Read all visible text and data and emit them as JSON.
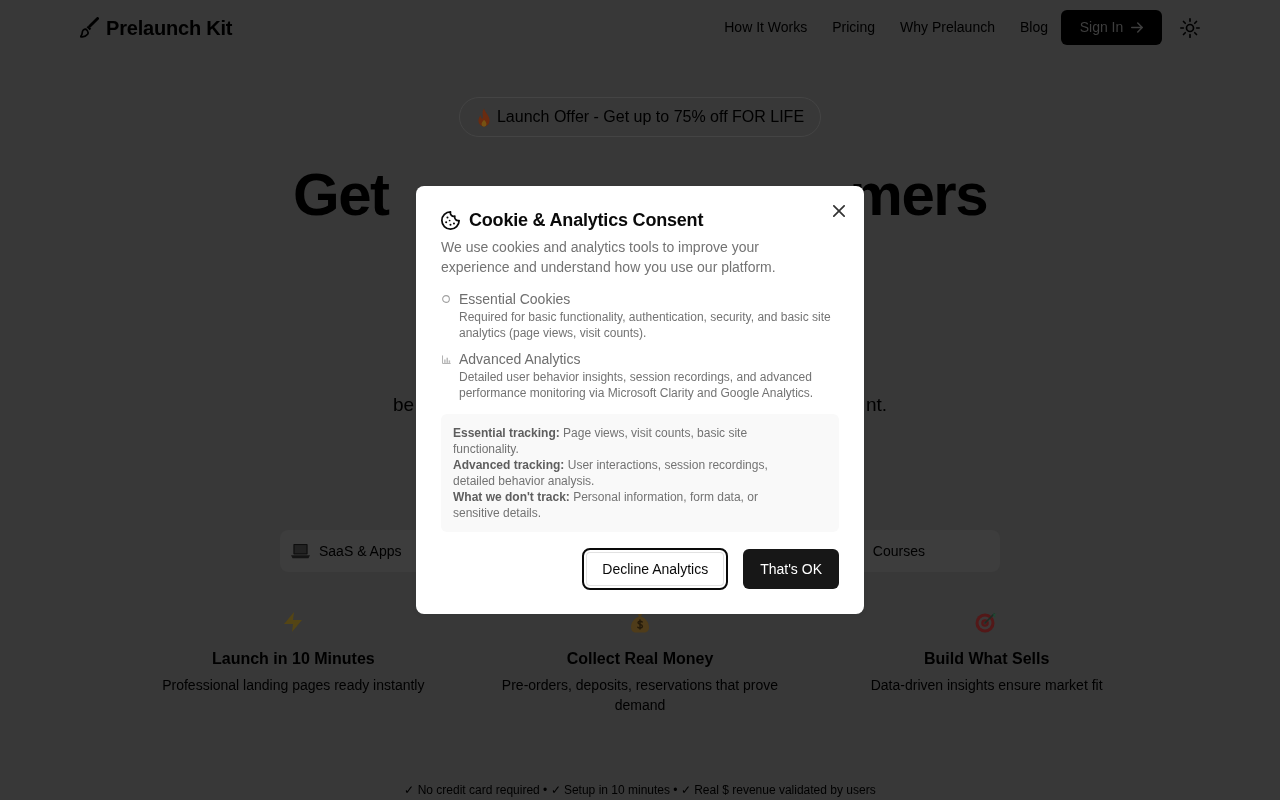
{
  "header": {
    "logo": "Prelaunch Kit",
    "nav_links": [
      "How It Works",
      "Pricing",
      "Why Prelaunch",
      "Blog"
    ],
    "sign_in": "Sign In"
  },
  "hero": {
    "offer_badge": "Launch Offer - Get up to 75% off FOR LIFE",
    "heading": {
      "left": "Get",
      "right": "mers"
    },
    "subtitle": {
      "left": "be",
      "right": "nt."
    }
  },
  "categories": [
    "SaaS & Apps",
    "Courses"
  ],
  "features": [
    {
      "title": "Launch in 10 Minutes",
      "description": "Professional landing pages ready instantly"
    },
    {
      "title": "Collect Real Money",
      "description": "Pre-orders, deposits, reservations that prove demand"
    },
    {
      "title": "Build What Sells",
      "description": "Data-driven insights ensure market fit"
    }
  ],
  "footer_note": "✓ No credit card required • ✓ Setup in 10 minutes • ✓ Real $ revenue validated by users",
  "consent_modal": {
    "title": "Cookie & Analytics Consent",
    "description": "We use cookies and analytics tools to improve your experience and understand how you use our platform.",
    "options": [
      {
        "title": "Essential Cookies",
        "description": "Required for basic functionality, authentication, security, and basic site analytics (page views, visit counts)."
      },
      {
        "title": "Advanced Analytics",
        "description": "Detailed user behavior insights, session recordings, and advanced performance monitoring via Microsoft Clarity and Google Analytics."
      }
    ],
    "details": [
      "**Essential tracking:** Page views, visit counts, basic site functionality.",
      "**Advanced tracking:** User interactions, session recordings, detailed behavior analysis.",
      "**What we don't track:** Personal information, form data, or sensitive details."
    ],
    "buttons": [
      {
        "label": "Decline Analytics",
        "kind": "outline",
        "focused": true
      },
      {
        "label": "That's OK",
        "kind": "primary",
        "focused": false
      }
    ]
  }
}
